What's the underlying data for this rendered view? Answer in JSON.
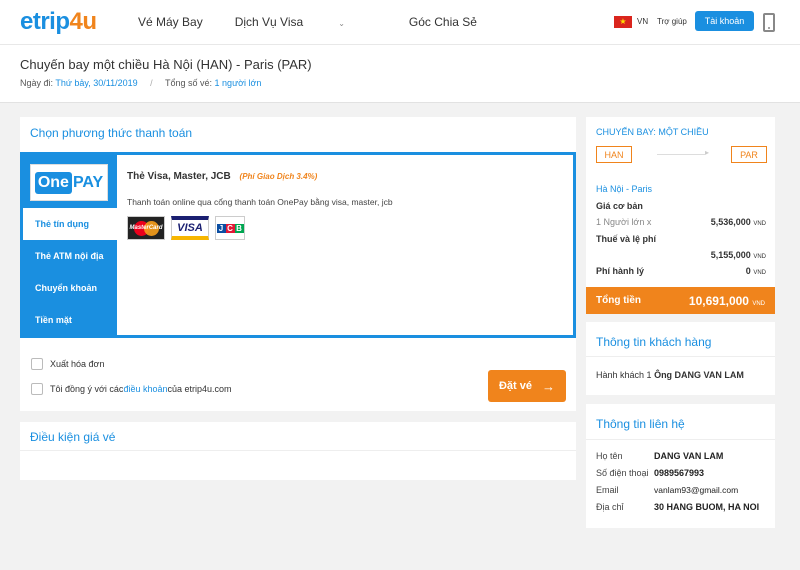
{
  "header": {
    "logo_part1": "etrip",
    "logo_part2": "4u",
    "nav": [
      "Vé Máy Bay",
      "Dịch Vụ Visa",
      "Góc Chia Sẻ"
    ],
    "flag": "★",
    "lang": "VN",
    "help": "Trợ giúp",
    "account": "Tài khoản"
  },
  "trip": {
    "title": "Chuyến bay một chiều Hà Nội (HAN) - Paris (PAR)",
    "date_label": "Ngày đi:",
    "date_value": "Thứ bảy, 30/11/2019",
    "tickets_label": "Tổng số vé:",
    "tickets_value": "1 người lớn"
  },
  "payment": {
    "title": "Chọn phương thức thanh toán",
    "methods": [
      "Thẻ tín dụng",
      "Thẻ ATM nội địa",
      "Chuyển khoản",
      "Tiền mặt"
    ],
    "selected_title": "Thẻ Visa, Master, JCB",
    "selected_fee": "(Phí Giao Dịch 3.4%)",
    "selected_desc": "Thanh toán online qua cổng thanh toán OnePay bằng visa, master, jcb",
    "logo_one": "One",
    "logo_pay": "PAY",
    "card_mc": "MasterCard",
    "card_visa": "VISA",
    "card_jcb": [
      "J",
      "C",
      "B"
    ]
  },
  "options": {
    "invoice": "Xuất hóa đơn",
    "agree_prefix": "Tôi đồng ý với các ",
    "agree_link": "điều khoản",
    "agree_suffix": " của etrip4u.com",
    "book": "Đặt vé",
    "book_arrow": "→"
  },
  "conditions": {
    "title": "Điều kiện giá vé"
  },
  "flight": {
    "title": "CHUYẾN BAY: MỘT CHIỀU",
    "from": "HAN",
    "to": "PAR",
    "route": "Hà Nội - Paris",
    "base_label": "Giá cơ bản",
    "adult_label": "1 Người lớn x",
    "adult_value": "5,536,000",
    "tax_label": "Thuế và lệ phí",
    "tax_value": "5,155,000",
    "service_label": "Phí hành lý",
    "service_value": "0",
    "currency": "VND",
    "total_label": "Tổng tiền",
    "total_value": "10,691,000"
  },
  "passenger": {
    "title": "Thông tin khách hàng",
    "label": "Hành khách 1",
    "name": "Ông DANG VAN LAM"
  },
  "contact": {
    "title": "Thông tin liên hệ",
    "rows": [
      {
        "k": "Họ tên",
        "v": "DANG VAN LAM"
      },
      {
        "k": "Số điện thoại",
        "v": "0989567993"
      },
      {
        "k": "Email",
        "v": "vanlam93@gmail.com"
      },
      {
        "k": "Địa chỉ",
        "v": "30 HANG BUOM, HA NOI"
      }
    ]
  }
}
